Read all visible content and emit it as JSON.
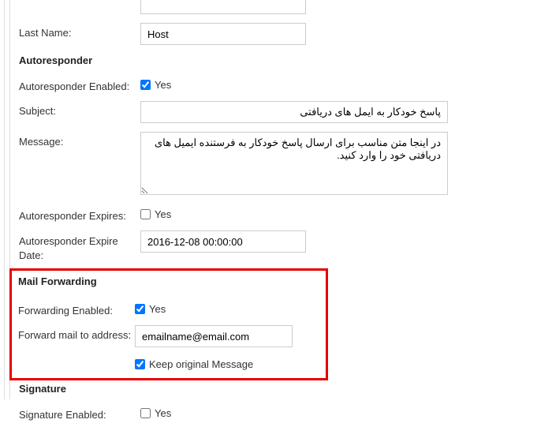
{
  "lastName": {
    "label": "Last Name:",
    "value": "Host"
  },
  "autoresponder": {
    "header": "Autoresponder",
    "enabledLabel": "Autoresponder Enabled:",
    "enabledYes": "Yes",
    "enabledChecked": true,
    "subjectLabel": "Subject:",
    "subjectValue": "پاسخ خودکار به ایمل های دریافتی",
    "messageLabel": "Message:",
    "messageValue": "در اینجا متن مناسب برای ارسال پاسخ خودکار به فرستنده ایمیل های دریافتی خود را وارد کنید.",
    "expiresLabel": "Autoresponder Expires:",
    "expiresYes": "Yes",
    "expiresChecked": false,
    "expireDateLabel": "Autoresponder Expire Date:",
    "expireDateValue": "2016-12-08 00:00:00"
  },
  "mailForwarding": {
    "header": "Mail Forwarding",
    "enabledLabel": "Forwarding Enabled:",
    "enabledYes": "Yes",
    "enabledChecked": true,
    "addressLabel": "Forward mail to address:",
    "addressValue": "emailname@email.com",
    "keepOriginalLabel": "Keep original Message",
    "keepOriginalChecked": true
  },
  "signature": {
    "header": "Signature",
    "enabledLabel": "Signature Enabled:",
    "enabledYes": "Yes",
    "enabledChecked": false
  }
}
